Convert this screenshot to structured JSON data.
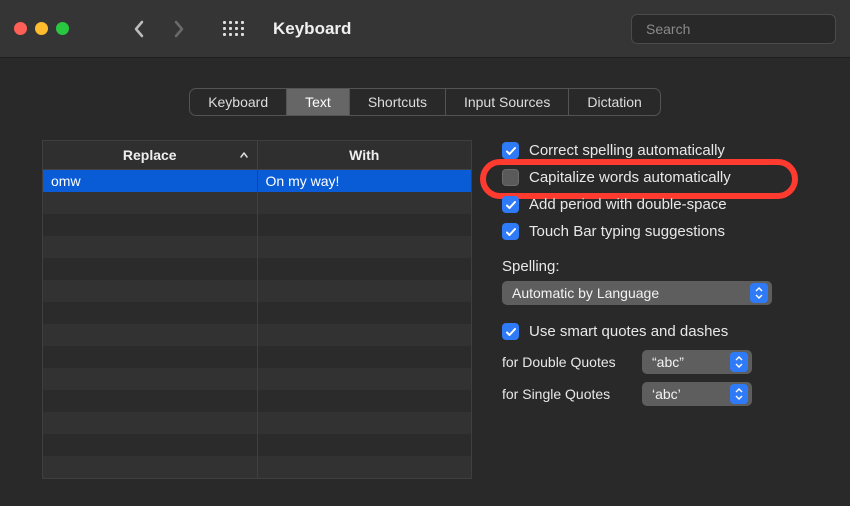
{
  "window": {
    "title": "Keyboard"
  },
  "search": {
    "placeholder": "Search",
    "value": ""
  },
  "tabs": {
    "t0": "Keyboard",
    "t1": "Text",
    "t2": "Shortcuts",
    "t3": "Input Sources",
    "t4": "Dictation"
  },
  "table": {
    "col_replace": "Replace",
    "col_with": "With",
    "rows": {
      "r0": {
        "replace": "omw",
        "with": "On my way!"
      }
    }
  },
  "options": {
    "correct_spelling": "Correct spelling automatically",
    "capitalize": "Capitalize words automatically",
    "add_period": "Add period with double-space",
    "touch_bar": "Touch Bar typing suggestions",
    "spelling_label": "Spelling:",
    "spelling_select": "Automatic by Language",
    "smart_quotes": "Use smart quotes and dashes",
    "double_label": "for Double Quotes",
    "double_value": "“abc”",
    "single_label": "for Single Quotes",
    "single_value": "‘abc’"
  }
}
